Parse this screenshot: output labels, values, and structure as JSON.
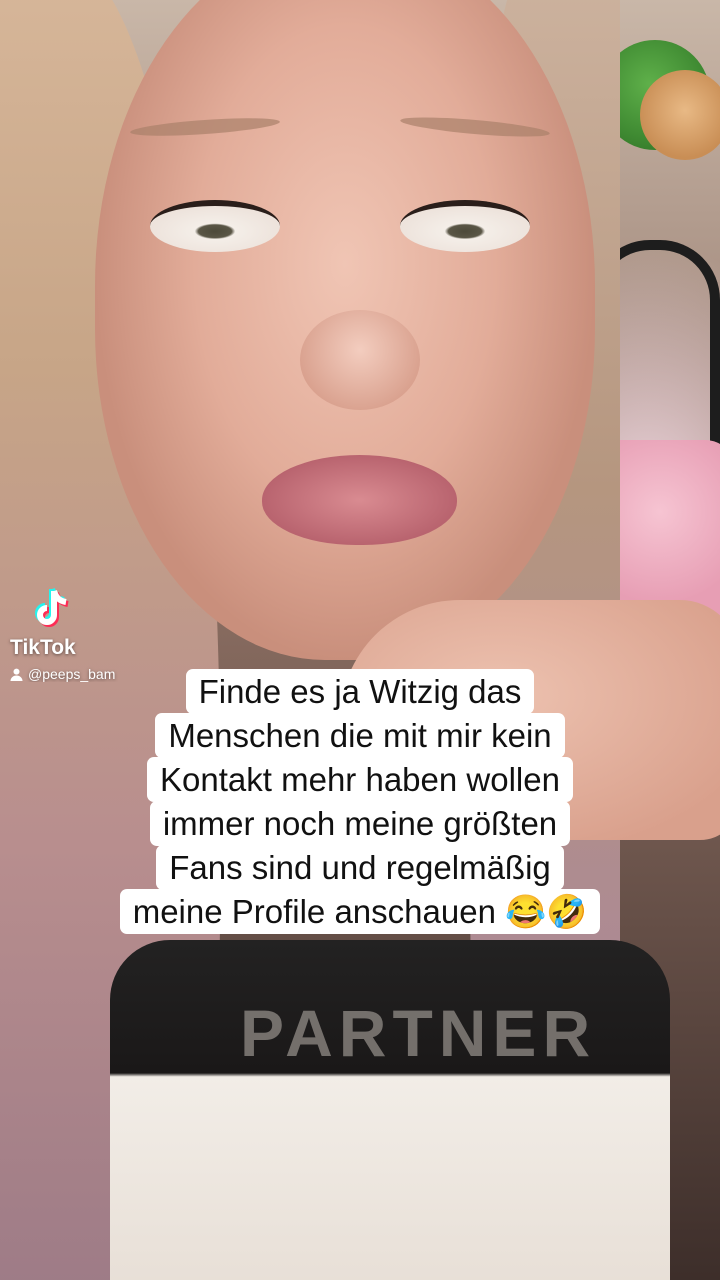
{
  "watermark": {
    "brand": "TikTok",
    "username": "@peeps_bam",
    "logo_icon": "tiktok-note-icon",
    "user_icon": "person-icon"
  },
  "caption": {
    "lines": [
      "Finde es ja Witzig das",
      "Menschen die mit mir kein",
      "Kontakt mehr haben wollen",
      "immer noch meine größten",
      "Fans sind und regelmäßig",
      "meine Profile anschauen 😂🤣"
    ]
  },
  "shirt_print": "PARTNER",
  "colors": {
    "caption_bg": "#ffffff",
    "caption_text": "#111111",
    "tiktok_cyan": "#25f4ee",
    "tiktok_red": "#fe2c55"
  }
}
